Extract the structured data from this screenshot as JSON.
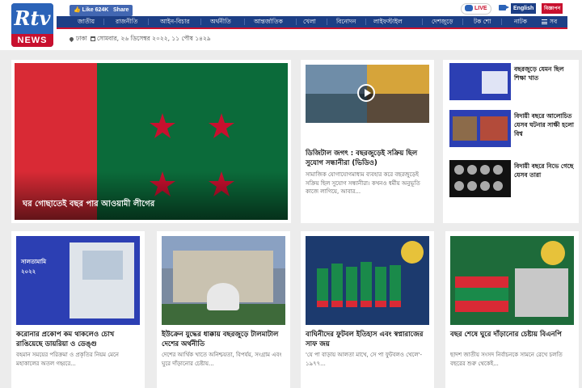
{
  "brand": {
    "logo_text": "Rtv",
    "logo_sub": "NEWS"
  },
  "social": {
    "like_label": "Like 624K",
    "share_label": "Share"
  },
  "topbar": {
    "live_label": "LIVE",
    "english_label": "English",
    "bangla_label": "বিজ্ঞাপন"
  },
  "nav": {
    "items": [
      "জাতীয়",
      "রাজনীতি",
      "আইন-বিচার",
      "অর্থনীতি",
      "আন্তর্জাতিক",
      "খেলা",
      "বিনোদন",
      "লাইফস্টাইল",
      "দেশজুড়ে",
      "টক শো",
      "নাটক"
    ],
    "all_label": "সব"
  },
  "dateline": {
    "city": "ঢাকা",
    "date": "সোমবার, ২৬ ডিসেম্বর ২০২২, ১১ পৌষ ১৪২৯"
  },
  "hero": {
    "title": "ঘর গোছাতেই বছর পার আওয়ামী লীগের"
  },
  "featured": {
    "title": "ডিজিটাল জগৎ : বছরজুড়েই সক্রিয় ছিল সুযোগ সন্ধানীরা (ভিডিও)",
    "summary": "সামাজিক যোগাযোগমাধ্যম ব্যবহার করে বছরজুড়েই সক্রিয় ছিল সুযোগ সন্ধানীরা। কখনও ধর্মীয় অনুভূতি কাজে লাগিয়ে, আবার..."
  },
  "side_news": [
    {
      "title": "বছরজুড়ে যেমন ছিল শিক্ষা খাত"
    },
    {
      "title": "বিদায়ী বছরে আলোচিত যেসব ঘটনার সাক্ষী হলো বিশ্ব"
    },
    {
      "title": "বিদায়ী বছরে নিভে গেছে যেসব তারা"
    }
  ],
  "bottom_news": [
    {
      "title": "করোনার প্রকোপ কম থাকলেও চোখ রাঙিয়েছে ডায়রিয়া ও ডেঙ্গু",
      "summary": "বহমান সময়ের পরিক্রমা ও প্রকৃতির নিয়ম মেনে মহাকালের অতল গহ্বরে...",
      "badge": "সালতামামি ২০২২"
    },
    {
      "title": "ইউক্রেন যুদ্ধের ধাক্কায় বছরজুড়ে টালমাটাল দেশের অর্থনীতি",
      "summary": "দেশের আর্থিক খাতে অনিশ্চয়তা, বিপর্যয়, সংগ্রাম এবং ঘুরে দাঁড়ানোর চেষ্টায়..."
    },
    {
      "title": "বাঘিনীদের ফুটবল ইতিহাস এবং স্বপ্নারাজের সাফ জয়",
      "summary": "'যে পা বাড়ায় আলতা মাখে, সে পা ফুটবলও খেলে'- ১৯৭৭..."
    },
    {
      "title": "বছর শেষে ঘুরে দাঁড়ানোর চেষ্টায় বিএনপি",
      "summary": "ছাদশ জাতীয় সংসদ নির্বাচনকে সামনে রেখে চলতি বছরের শুরু থেকেই..."
    }
  ],
  "colors": {
    "brand_blue": "#1d3f86",
    "accent_red": "#c8102e",
    "flag_green": "#0b6b3a",
    "flag_red": "#d92a35"
  }
}
